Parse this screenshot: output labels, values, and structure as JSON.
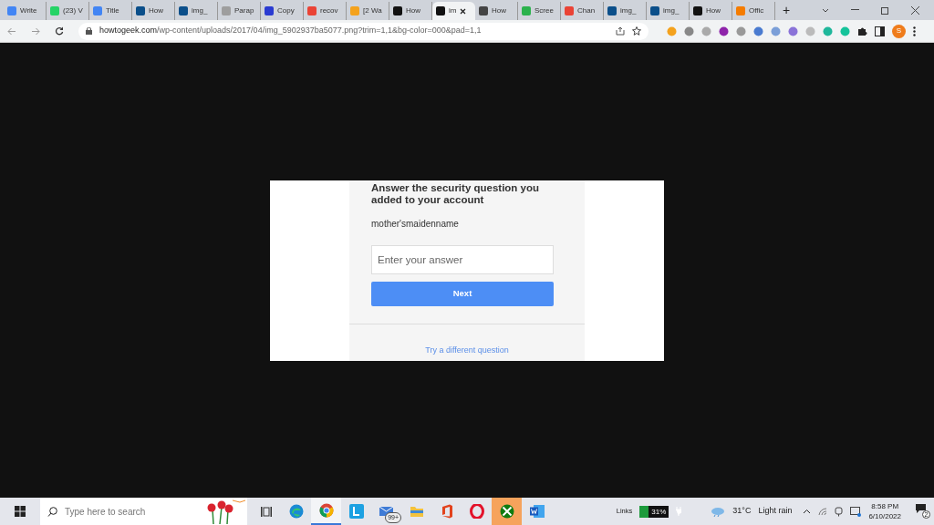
{
  "browser": {
    "tabs": [
      {
        "label": "Write",
        "selected": false,
        "color": "#4285f4"
      },
      {
        "label": "(23) V",
        "selected": false,
        "color": "#25d366"
      },
      {
        "label": "Title",
        "selected": false,
        "color": "#4285f4"
      },
      {
        "label": "How",
        "selected": false,
        "color": "#0b4f8a"
      },
      {
        "label": "img_",
        "selected": false,
        "color": "#0b4f8a"
      },
      {
        "label": "Parap",
        "selected": false,
        "color": "#9e9e9e"
      },
      {
        "label": "Copy",
        "selected": false,
        "color": "#2a3bd1"
      },
      {
        "label": "recov",
        "selected": false,
        "color": "#ea4335"
      },
      {
        "label": "[2 Wa",
        "selected": false,
        "color": "#f4a21d"
      },
      {
        "label": "How",
        "selected": false,
        "color": "#111111"
      },
      {
        "label": "im",
        "selected": true,
        "color": "#111111"
      },
      {
        "label": "How",
        "selected": false,
        "color": "#444444"
      },
      {
        "label": "Scree",
        "selected": false,
        "color": "#2bb24c"
      },
      {
        "label": "Chan",
        "selected": false,
        "color": "#ea4335"
      },
      {
        "label": "img_",
        "selected": false,
        "color": "#0b4f8a"
      },
      {
        "label": "img_",
        "selected": false,
        "color": "#0b4f8a"
      },
      {
        "label": "How",
        "selected": false,
        "color": "#111111"
      },
      {
        "label": "Offic",
        "selected": false,
        "color": "#f57c00"
      }
    ],
    "new_tab": "+",
    "url_host": "howtogeek.com",
    "url_path": "/wp-content/uploads/2017/04/img_5902937ba5077.png?trim=1,1&bg-color=000&pad=1,1",
    "profile_initial": "S"
  },
  "page": {
    "heading": "Answer the security question you added to your account",
    "question": "mother'smaidenname",
    "answer": {
      "placeholder": "Enter your answer"
    },
    "next_button": "Next",
    "link": "Try a different question"
  },
  "taskbar": {
    "search": {
      "placeholder": "Type here to search"
    },
    "apps": [
      {
        "kind": "taskview",
        "selected": false
      },
      {
        "kind": "edge",
        "selected": false
      },
      {
        "kind": "chrome",
        "selected": true
      },
      {
        "kind": "l",
        "selected": false
      },
      {
        "kind": "mail",
        "selected": false
      },
      {
        "kind": "folder",
        "selected": false
      },
      {
        "kind": "office",
        "selected": false
      },
      {
        "kind": "opera",
        "selected": false
      },
      {
        "kind": "xbox",
        "selected": false
      },
      {
        "kind": "word",
        "selected": false
      }
    ],
    "mail_badge": "99+",
    "links": "Links",
    "battery": {
      "reading": "31%",
      "level": 0.31
    },
    "temperature": "31°C",
    "weather": "Light rain",
    "time": "8:58 PM",
    "date": "6/10/2022",
    "notifications": "2"
  }
}
